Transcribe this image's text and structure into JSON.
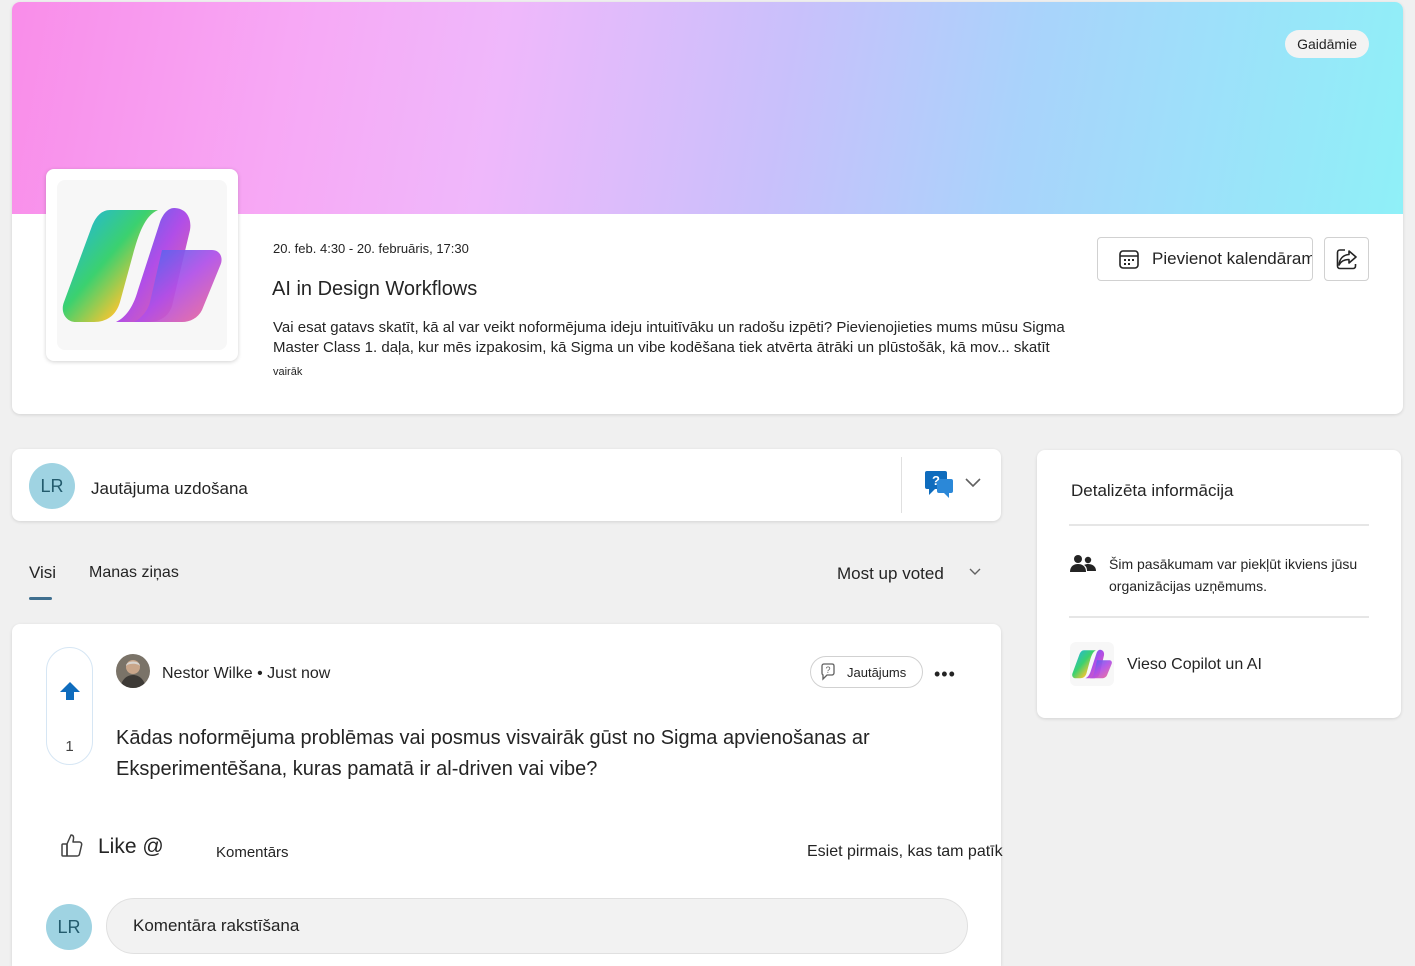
{
  "header": {
    "badge": "Gaidāmie",
    "date_range": "20. feb. 4:30 - 20. februāris, 17:30",
    "title": "AI in Design Workflows",
    "description": "Vai esat gatavs skatīt, kā al var veikt noformējuma ideju intuitīvāku un radošu izpēti? Pievienojieties mums mūsu Sigma Master Class 1. daļa, kur mēs izpakosim, kā Sigma un vibe kodēšana tiek atvērta ātrāki un plūstošāk, kā mov... skatīt",
    "more_link": "vairāk",
    "add_calendar_label": "Pievienot kalendāram"
  },
  "ask": {
    "avatar_initials": "LR",
    "label": "Jautājuma uzdošana"
  },
  "tabs": {
    "all": "Visi",
    "mine": "Manas ziņas",
    "sort": "Most up voted"
  },
  "post": {
    "vote_count": "1",
    "author_line": "Nestor Wilke • Just now",
    "type_pill": "Jautājums",
    "body": "Kādas noformējuma problēmas vai posmus visvairāk gūst no Sigma apvienošanas ar Eksperimentēšana, kuras pamatā ir al-driven vai vibe?",
    "like_label": "Like @",
    "comment_label": "Komentārs",
    "first_like_text": "Esiet pirmais, kas tam patīk",
    "commenter_initials": "LR",
    "comment_placeholder": "Komentāra rakstīšana"
  },
  "details": {
    "title": "Detalizēta informācija",
    "access_text": "Šim pasākumam var piekļūt ikviens jūsu organizācijas uzņēmums.",
    "community_name": "Vieso Copilot un AI"
  },
  "colors": {
    "accent": "#3f6f8f",
    "upvote": "#0f6cbd",
    "avatar_bg": "#9fd3e2"
  }
}
